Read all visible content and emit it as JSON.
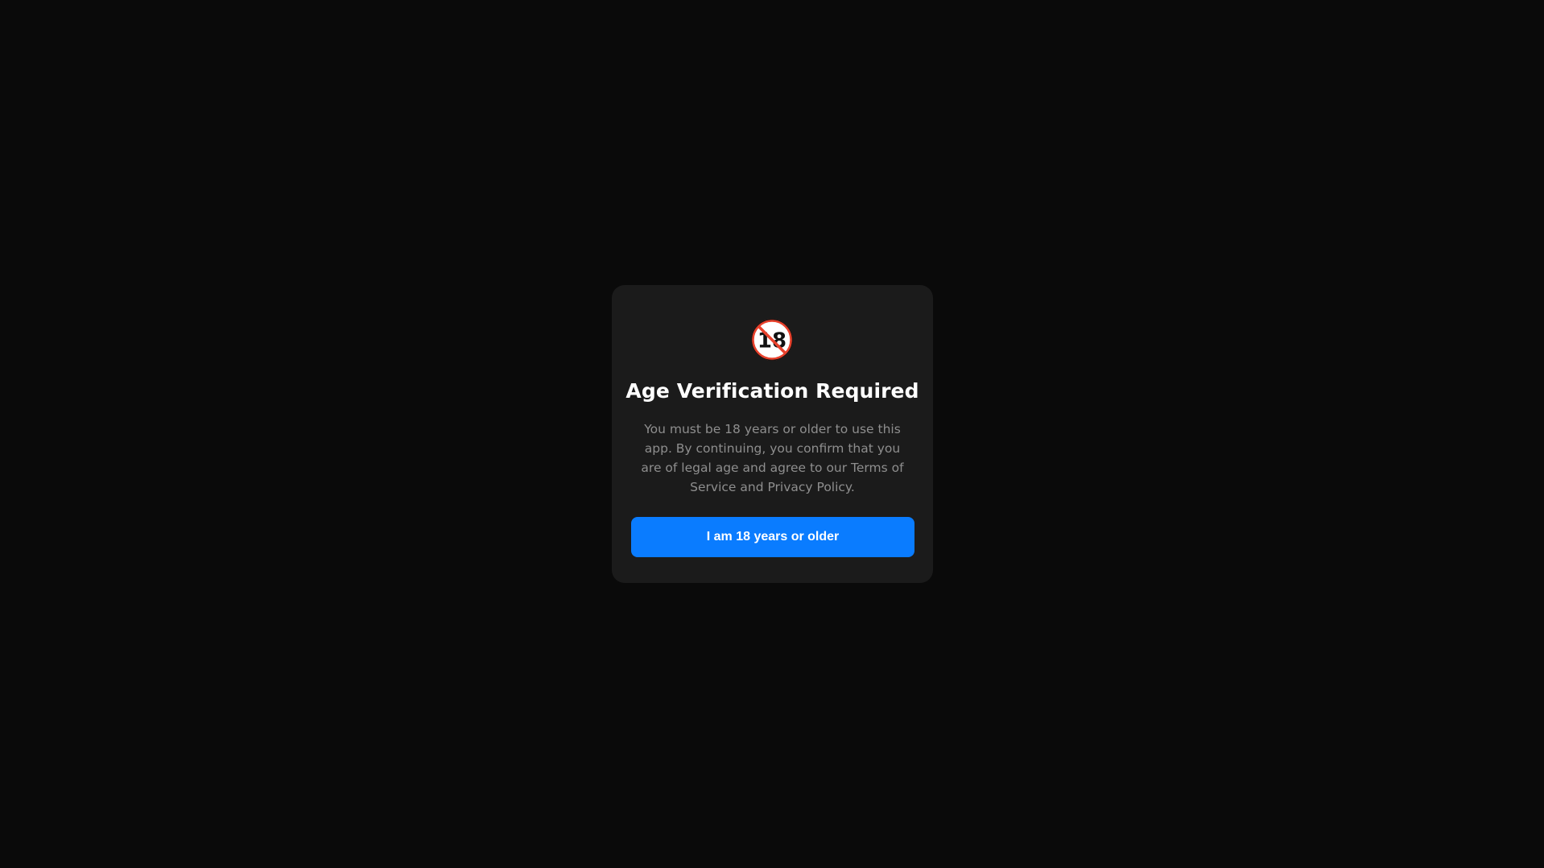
{
  "modal": {
    "icon": "no-under-18-icon",
    "icon_text": "18",
    "title": "Age Verification Required",
    "message": "You must be 18 years or older to use this app. By continuing, you confirm that you are of legal age and agree to our Terms of Service and Privacy Policy.",
    "confirm_label": "I am 18 years or older"
  },
  "colors": {
    "background": "#0a0a0a",
    "modal_background": "#1b1b1b",
    "title": "#ffffff",
    "message": "#8e8e8e",
    "button": "#0a7cff",
    "button_text": "#ffffff",
    "icon_ring": "#e8412c"
  }
}
